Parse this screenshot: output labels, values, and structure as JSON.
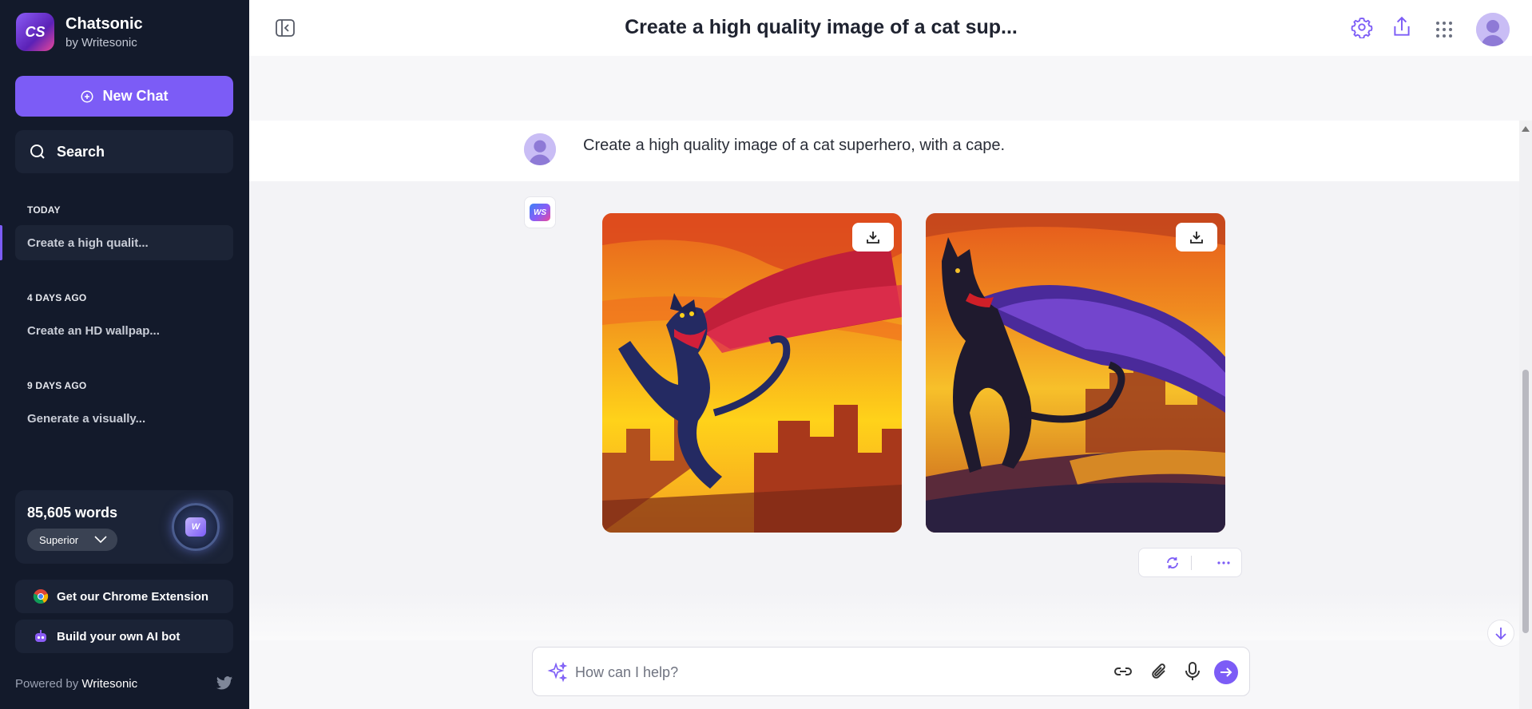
{
  "sidebar": {
    "brand_name": "Chatsonic",
    "brand_sub": "by Writesonic",
    "brand_logo_text": "CS",
    "new_chat_label": "New Chat",
    "search_label": "Search",
    "sections": [
      {
        "label": "TODAY",
        "items": [
          "Create a high qualit..."
        ]
      },
      {
        "label": "4 DAYS AGO",
        "items": [
          "Create an HD wallpap..."
        ]
      },
      {
        "label": "9 DAYS AGO",
        "items": [
          "Generate a visually..."
        ]
      }
    ],
    "words_count": "85,605 words",
    "plan": "Superior",
    "chrome_extension": "Get our Chrome Extension",
    "build_bot": "Build your own AI bot",
    "powered_prefix": "Powered by",
    "powered_brand": "Writesonic"
  },
  "header": {
    "title": "Create a high quality image of a cat sup..."
  },
  "chat": {
    "user_message": "Create a high quality image of a cat superhero, with a cape.",
    "bot_logo_text": "WS",
    "images": [
      {
        "description": "black cat superhero leaping with red cape at sunset"
      },
      {
        "description": "black cat superhero with purple cape over burning city"
      }
    ]
  },
  "input": {
    "placeholder": "How can I help?"
  },
  "colors": {
    "accent": "#7c5cf6",
    "sidebar_bg": "#131a2b",
    "sidebar_card": "#1b2336"
  },
  "icons": [
    "plus-circle-icon",
    "search-icon",
    "chevron-down-icon",
    "chrome-icon",
    "bot-icon",
    "twitter-icon",
    "collapse-sidebar-icon",
    "settings-icon",
    "share-icon",
    "apps-grid-icon",
    "download-icon",
    "regenerate-icon",
    "more-icon",
    "sparkle-icon",
    "link-icon",
    "paperclip-icon",
    "microphone-icon",
    "send-arrow-icon",
    "arrow-down-icon"
  ]
}
